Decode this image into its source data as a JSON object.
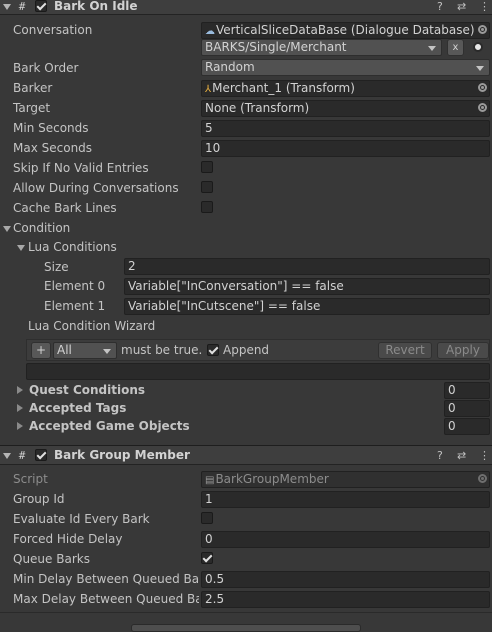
{
  "bark_on_idle": {
    "title": "Bark On Idle",
    "enabled": true,
    "rows": {
      "conversation_label": "Conversation",
      "conversation_db": "VerticalSliceDataBase (Dialogue Database)",
      "conversation_value": "BARKS/Single/Merchant",
      "conversation_clear": "x",
      "bark_order_label": "Bark Order",
      "bark_order_value": "Random",
      "barker_label": "Barker",
      "barker_value": "Merchant_1 (Transform)",
      "target_label": "Target",
      "target_value": "None (Transform)",
      "min_seconds_label": "Min Seconds",
      "min_seconds_value": "5",
      "max_seconds_label": "Max Seconds",
      "max_seconds_value": "10",
      "skip_label": "Skip If No Valid Entries",
      "skip_checked": false,
      "allow_label": "Allow During Conversations",
      "allow_checked": false,
      "cache_label": "Cache Bark Lines",
      "cache_checked": false
    },
    "condition": {
      "label": "Condition",
      "lua_label": "Lua Conditions",
      "size_label": "Size",
      "size_value": "2",
      "element0_label": "Element 0",
      "element0_value": "Variable[\"InConversation\"] == false",
      "element1_label": "Element 1",
      "element1_value": "Variable[\"InCutscene\"] == false",
      "wizard_label": "Lua Condition Wizard",
      "wizard_add": "+",
      "wizard_mode": "All",
      "wizard_must": "must be true.",
      "wizard_append": "Append",
      "wizard_append_checked": true,
      "wizard_revert": "Revert",
      "wizard_apply": "Apply",
      "quest_label": "Quest Conditions",
      "quest_value": "0",
      "tags_label": "Accepted Tags",
      "tags_value": "0",
      "objects_label": "Accepted Game Objects",
      "objects_value": "0"
    }
  },
  "bark_group_member": {
    "title": "Bark Group Member",
    "enabled": true,
    "rows": {
      "script_label": "Script",
      "script_value": "BarkGroupMember",
      "group_id_label": "Group Id",
      "group_id_value": "1",
      "evaluate_label": "Evaluate Id Every Bark",
      "evaluate_checked": false,
      "forced_label": "Forced Hide Delay",
      "forced_value": "0",
      "queue_label": "Queue Barks",
      "queue_checked": true,
      "min_delay_label": "Min Delay Between Queued Bark",
      "min_delay_value": "0.5",
      "max_delay_label": "Max Delay Between Queued Bark",
      "max_delay_value": "2.5"
    }
  },
  "header_icons": [
    "help-icon",
    "presets-icon",
    "kebab-menu-icon"
  ],
  "colors": {
    "background": "#383838",
    "field": "#2a2a2a",
    "header": "#3e3e3e"
  }
}
